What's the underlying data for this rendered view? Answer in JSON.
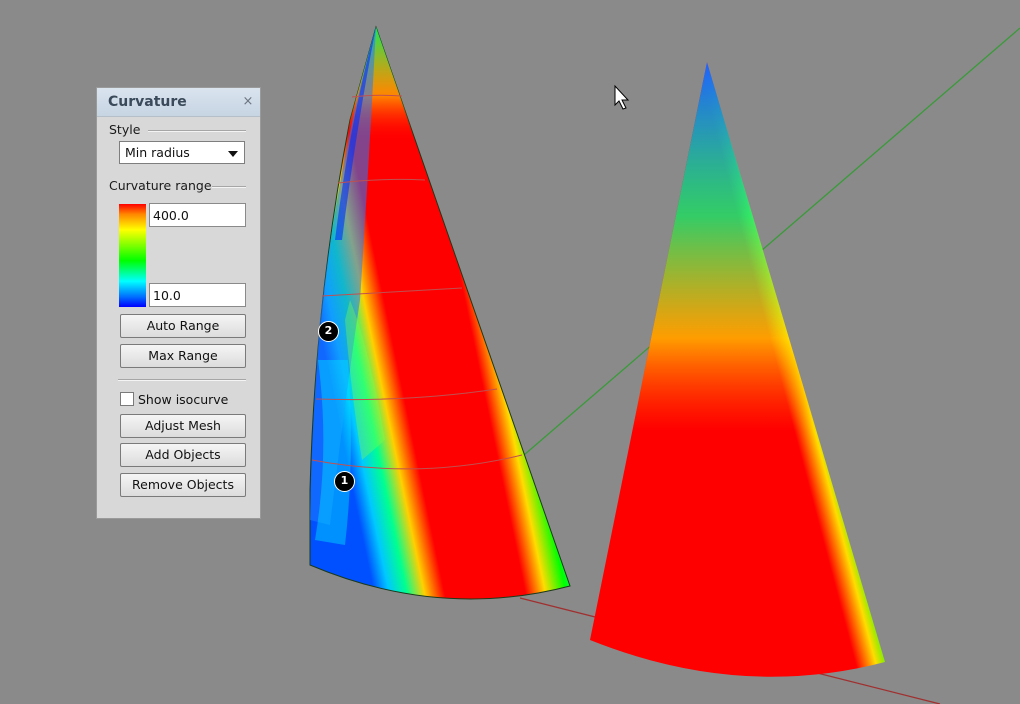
{
  "panel": {
    "title": "Curvature",
    "close_glyph": "×",
    "style_label": "Style",
    "style_value": "Min radius",
    "range_label": "Curvature range",
    "range_max": "400.0",
    "range_min": "10.0",
    "auto_range_label": "Auto Range",
    "max_range_label": "Max Range",
    "show_isocurve_label": "Show isocurve",
    "show_isocurve_checked": false,
    "adjust_mesh_label": "Adjust Mesh",
    "add_objects_label": "Add Objects",
    "remove_objects_label": "Remove Objects"
  },
  "markers": [
    "1",
    "2"
  ],
  "colors": {
    "viewport_background": "#8a8a8a",
    "axis_green": "#3a9a3a",
    "axis_red": "#a03030",
    "panel_bg": "#d8d8d8"
  },
  "icons": [
    "close-icon",
    "dropdown-arrow-icon",
    "mouse-cursor-icon"
  ]
}
